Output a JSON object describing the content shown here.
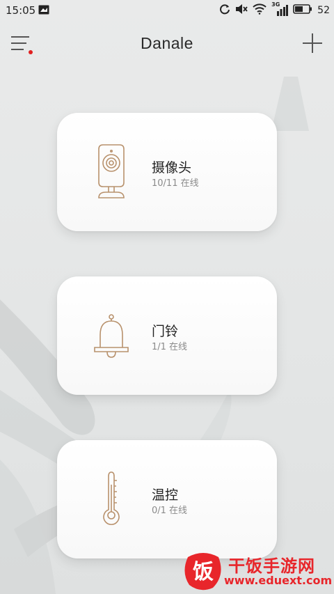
{
  "status_bar": {
    "time": "15:05",
    "network": "3G",
    "battery": "52"
  },
  "header": {
    "title": "Danale"
  },
  "cards": [
    {
      "label": "摄像头",
      "status": "10/11 在线",
      "icon": "camera-icon"
    },
    {
      "label": "门铃",
      "status": "1/1 在线",
      "icon": "bell-icon"
    },
    {
      "label": "温控",
      "status": "0/1 在线",
      "icon": "thermometer-icon"
    }
  ],
  "watermark": {
    "logo_char": "饭",
    "title": "干饭手游网",
    "url": "www.eduext.com"
  },
  "colors": {
    "accent_icon": "#b8916c",
    "menu_dot": "#e02020",
    "watermark_red": "#e8262b"
  }
}
